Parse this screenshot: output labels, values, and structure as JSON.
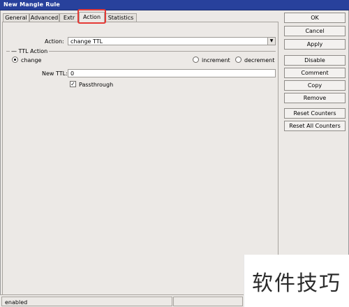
{
  "window": {
    "title": "New Mangle Rule"
  },
  "tabs": [
    {
      "label": "General"
    },
    {
      "label": "Advanced"
    },
    {
      "label": "Extr"
    },
    {
      "label": "Action"
    },
    {
      "label": "Statistics"
    }
  ],
  "action_tab": {
    "action_label": "Action:",
    "action_value": "change TTL",
    "ttl_group_label": "TTL Action",
    "radios": [
      {
        "label": "change",
        "selected": true
      },
      {
        "label": "increment",
        "selected": false
      },
      {
        "label": "decrement",
        "selected": false
      }
    ],
    "new_ttl_label": "New TTL:",
    "new_ttl_value": "0",
    "passthrough_label": "Passthrough",
    "passthrough_checked": true
  },
  "buttons": {
    "ok": "OK",
    "cancel": "Cancel",
    "apply": "Apply",
    "disable": "Disable",
    "comment": "Comment",
    "copy": "Copy",
    "remove": "Remove",
    "reset_counters": "Reset Counters",
    "reset_all_counters": "Reset All Counters"
  },
  "status_bar": {
    "state": "enabled"
  },
  "watermark": {
    "text": "软件技巧"
  },
  "colors": {
    "titlebar": "#28419c",
    "highlight": "#e53935",
    "window_bg": "#ece9e6"
  }
}
